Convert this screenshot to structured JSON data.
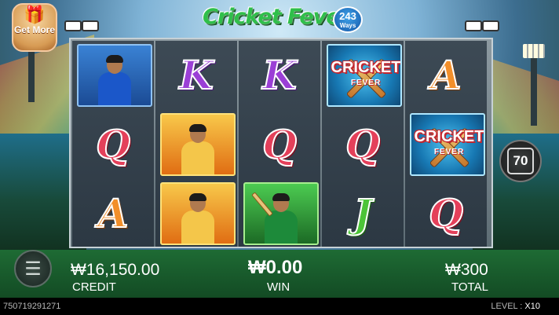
{
  "header": {
    "title": "Cricket Fever",
    "ways_number": "243",
    "ways_label": "Ways",
    "get_more": "Get More"
  },
  "reels": {
    "col1": {
      "row1": "player-blue",
      "row2": "Q",
      "row3": "A"
    },
    "col2": {
      "row1": "K",
      "row2": "player-gold",
      "row3": "player-gold"
    },
    "col3": {
      "row1": "K",
      "row2": "Q",
      "row3": "batsman-green"
    },
    "col4": {
      "row1": "wild",
      "row2": "Q",
      "row3": "J"
    },
    "col5": {
      "row1": "A",
      "row2": "wild",
      "row3": "Q"
    },
    "letters": {
      "K": "K",
      "Q": "Q",
      "A": "A",
      "J": "J"
    },
    "wild_title": "CRICKET",
    "wild_sub": "FEVER"
  },
  "auto_spin": {
    "value": "70"
  },
  "bottom": {
    "credit_value": "₩16,150.00",
    "credit_label": "CREDIT",
    "win_value": "₩0.00",
    "win_label": "WIN",
    "total_value": "₩300",
    "total_label": "TOTAL",
    "menu_icon": "hamburger-menu-icon"
  },
  "footer": {
    "round_id": "750719291271",
    "level_label": "LEVEL : ",
    "level_value": "X10"
  }
}
